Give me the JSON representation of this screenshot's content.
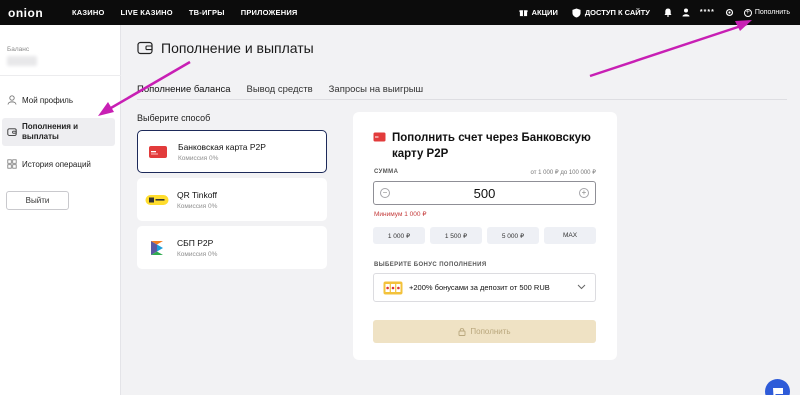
{
  "header": {
    "logo": "onion",
    "nav": [
      "КАЗИНО",
      "LIVE КАЗИНО",
      "ТВ-ИГРЫ",
      "ПРИЛОЖЕНИЯ"
    ],
    "promotions": "АКЦИИ",
    "site_access": "ДОСТУП К САЙТУ",
    "masked_user": "****",
    "deposit": "Пополнить"
  },
  "sidebar": {
    "balance_label": "Баланс",
    "items": [
      {
        "label": "Мой профиль",
        "icon": "user-icon"
      },
      {
        "label": "Пополнения и выплаты",
        "icon": "wallet-icon",
        "active": true
      },
      {
        "label": "История операций",
        "icon": "grid-icon"
      }
    ],
    "logout": "Выйти"
  },
  "main": {
    "title": "Пополнение и выплаты",
    "tabs": [
      {
        "label": "Пополнение баланса",
        "active": true
      },
      {
        "label": "Вывод средств"
      },
      {
        "label": "Запросы на выигрыш"
      }
    ],
    "choose_method": "Выберите способ",
    "methods": [
      {
        "name": "Банковская карта P2P",
        "fee": "Комиссия 0%",
        "icon": "bank-card-icon"
      },
      {
        "name": "QR Tinkoff",
        "fee": "Комиссия 0%",
        "icon": "qr-tinkoff-icon"
      },
      {
        "name": "СБП P2P",
        "fee": "Комиссия 0%",
        "icon": "sbp-icon"
      }
    ]
  },
  "panel": {
    "title": "Пополнить счет через Банковскую карту P2P",
    "sum_label": "СУММА",
    "range": "от 1 000 ₽ до 100 000 ₽",
    "amount": "500",
    "min_note": "Минимум 1 000 ₽",
    "quick_amounts": [
      "1 000 ₽",
      "1 500 ₽",
      "5 000 ₽",
      "MAX"
    ],
    "bonus_label": "ВЫБЕРИТЕ БОНУС ПОПОЛНЕНИЯ",
    "bonus_option": "+200% бонусами за депозит от 500 RUB",
    "submit": "Пополнить"
  },
  "colors": {
    "topbar": "#0c0c0c",
    "active_border": "#1d2a5a",
    "error": "#c43a3a",
    "submit_bg": "#efe2c4",
    "annotation": "#c81fb4",
    "chat": "#2e5bd8"
  }
}
